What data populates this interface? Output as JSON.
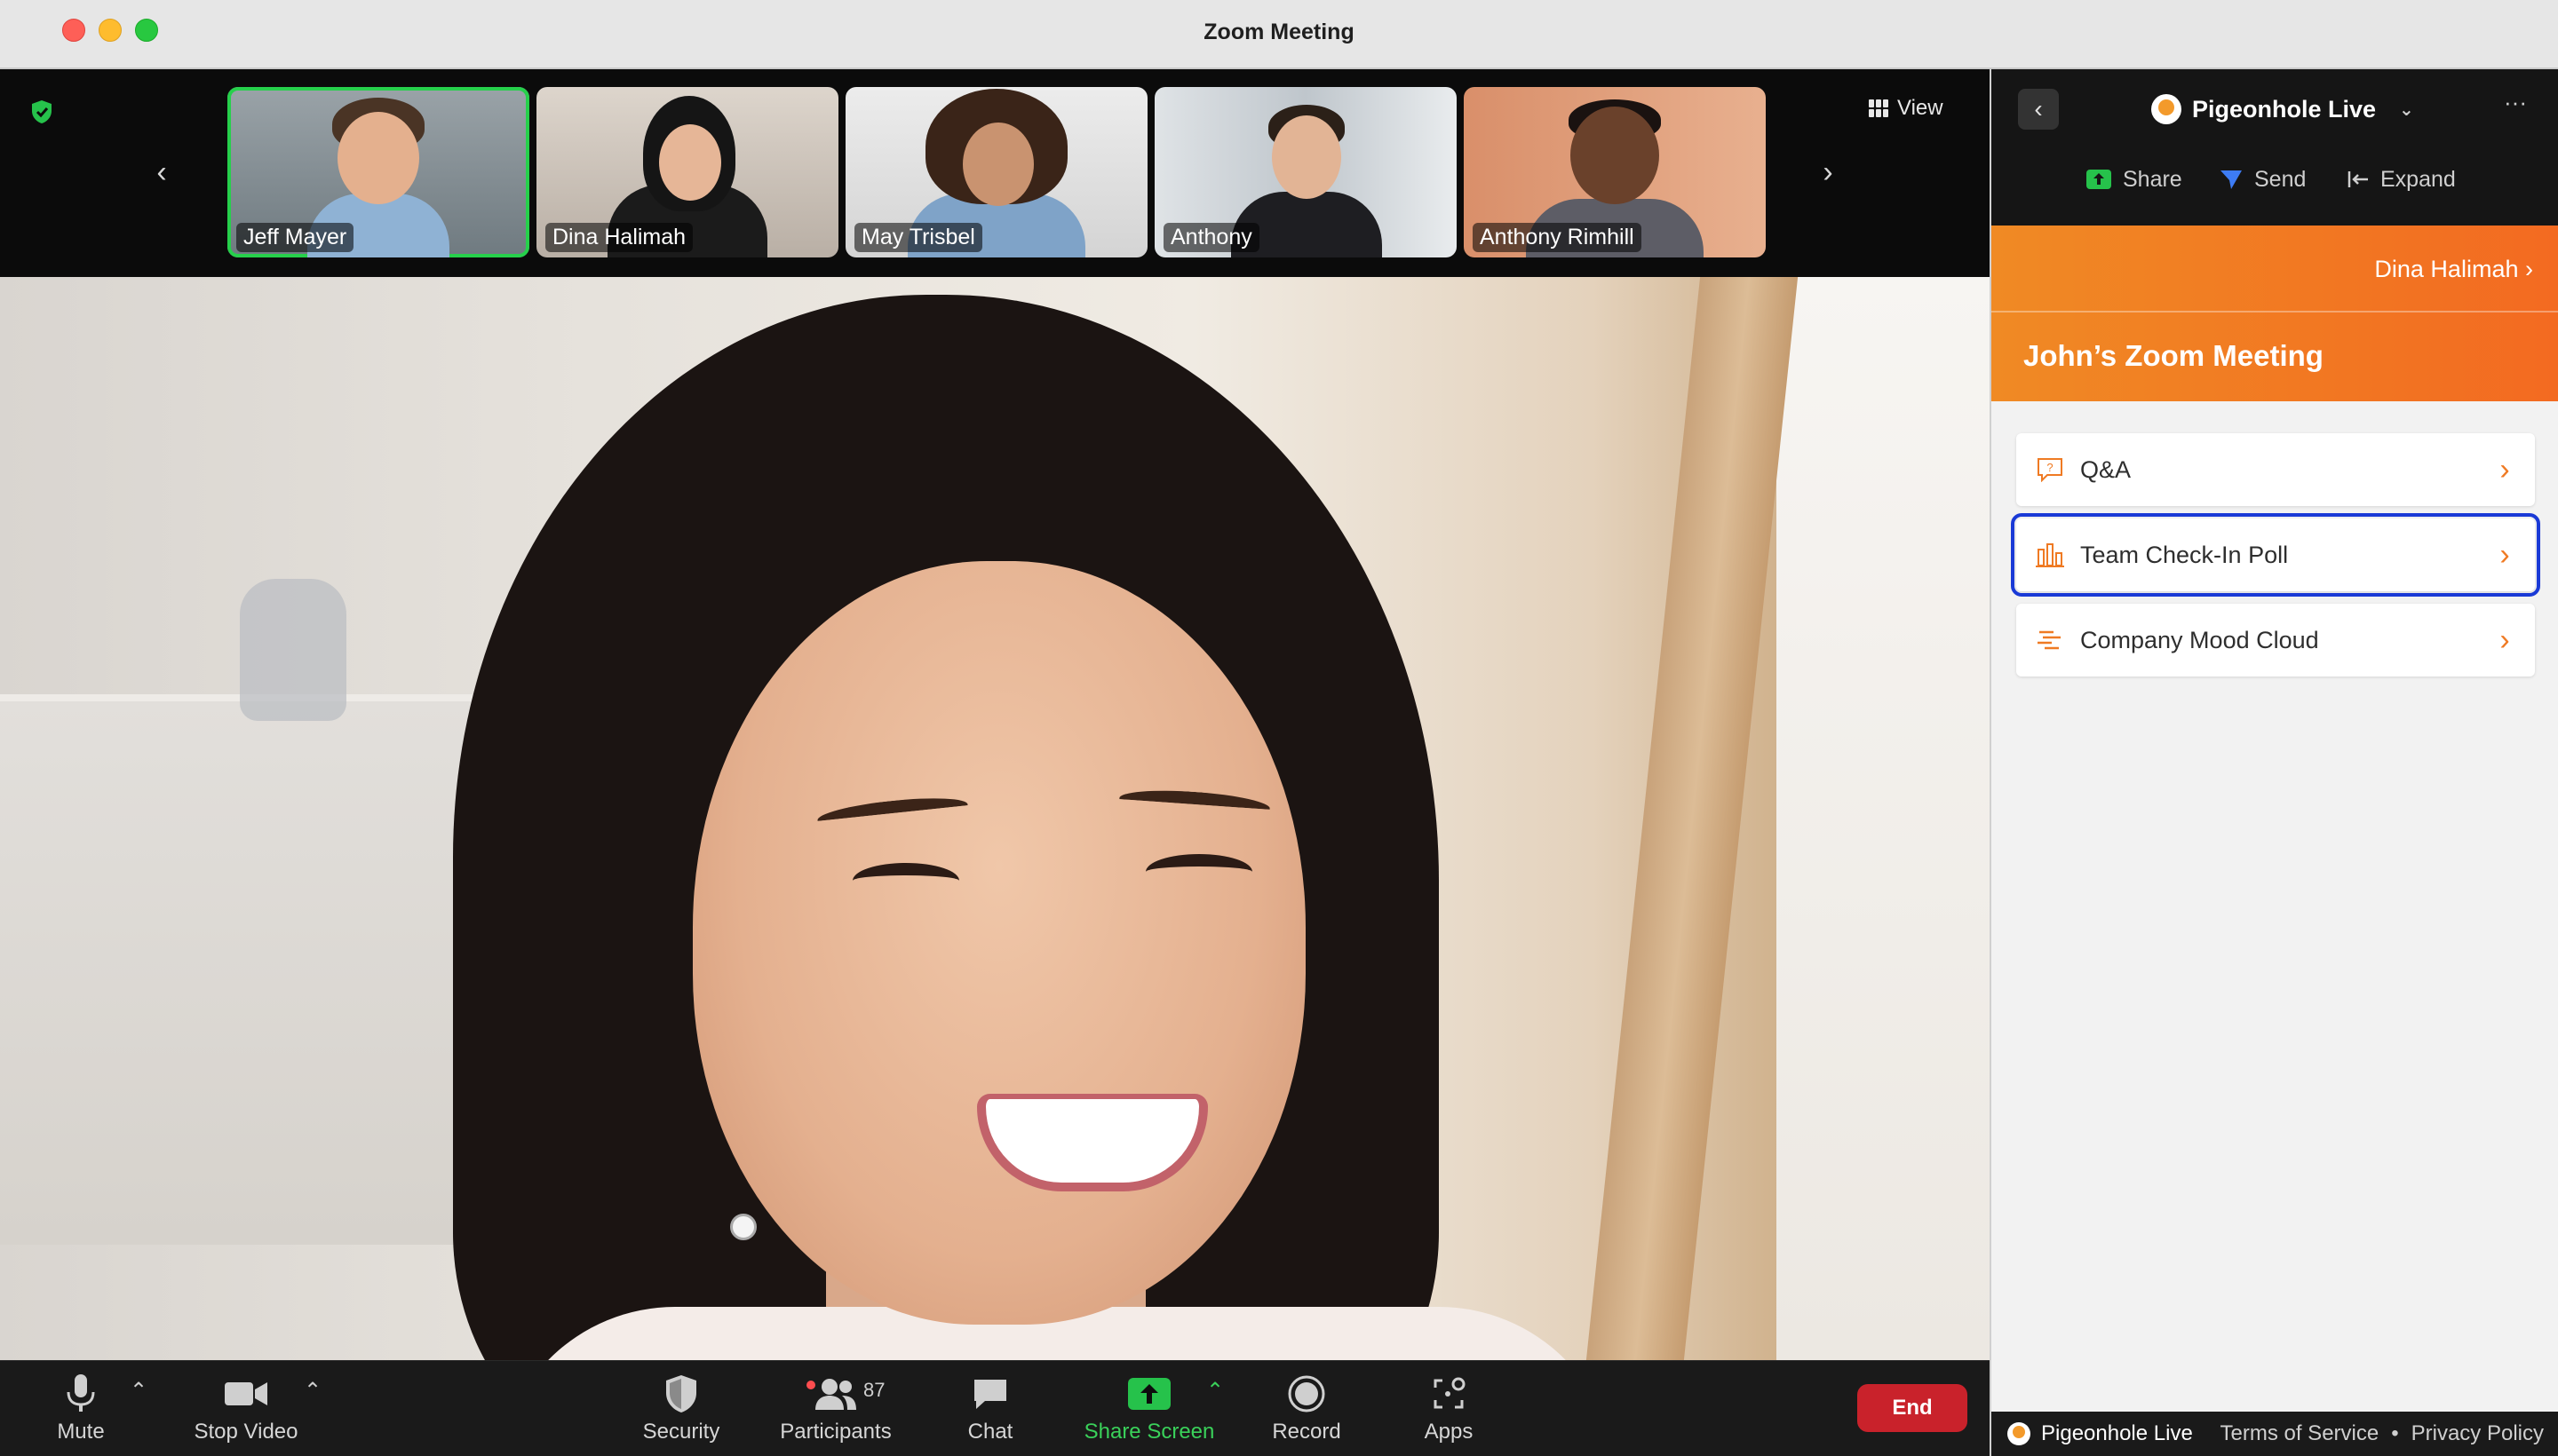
{
  "window": {
    "title": "Zoom Meeting"
  },
  "filmstrip": {
    "view_label": "View",
    "participants": [
      {
        "name": "Jeff Mayer",
        "active": true
      },
      {
        "name": "Dina Halimah",
        "active": false
      },
      {
        "name": "May Trisbel",
        "active": false
      },
      {
        "name": "Anthony",
        "active": false
      },
      {
        "name": "Anthony Rimhill",
        "active": false
      }
    ]
  },
  "toolbar": {
    "mute": "Mute",
    "stop_video": "Stop Video",
    "security": "Security",
    "participants": "Participants",
    "participants_count": "87",
    "chat": "Chat",
    "share_screen": "Share Screen",
    "record": "Record",
    "apps": "Apps",
    "end": "End"
  },
  "panel": {
    "app_name": "Pigeonhole Live",
    "actions": {
      "share": "Share",
      "send": "Send",
      "expand": "Expand"
    },
    "banner": {
      "user": "Dina Halimah",
      "title": "John’s Zoom Meeting"
    },
    "items": [
      {
        "label": "Q&A",
        "icon": "qa-icon"
      },
      {
        "label": "Team Check-In Poll",
        "icon": "poll-bars-icon"
      },
      {
        "label": "Company Mood Cloud",
        "icon": "word-cloud-icon"
      }
    ],
    "footer": {
      "brand": "Pigeonhole Live",
      "terms": "Terms of Service",
      "separator": "•",
      "privacy": "Privacy Policy"
    }
  },
  "colors": {
    "accent_orange": "#f08a24",
    "active_green": "#26d04b",
    "end_red": "#c9222b",
    "highlight_blue": "#1a3ad6"
  }
}
